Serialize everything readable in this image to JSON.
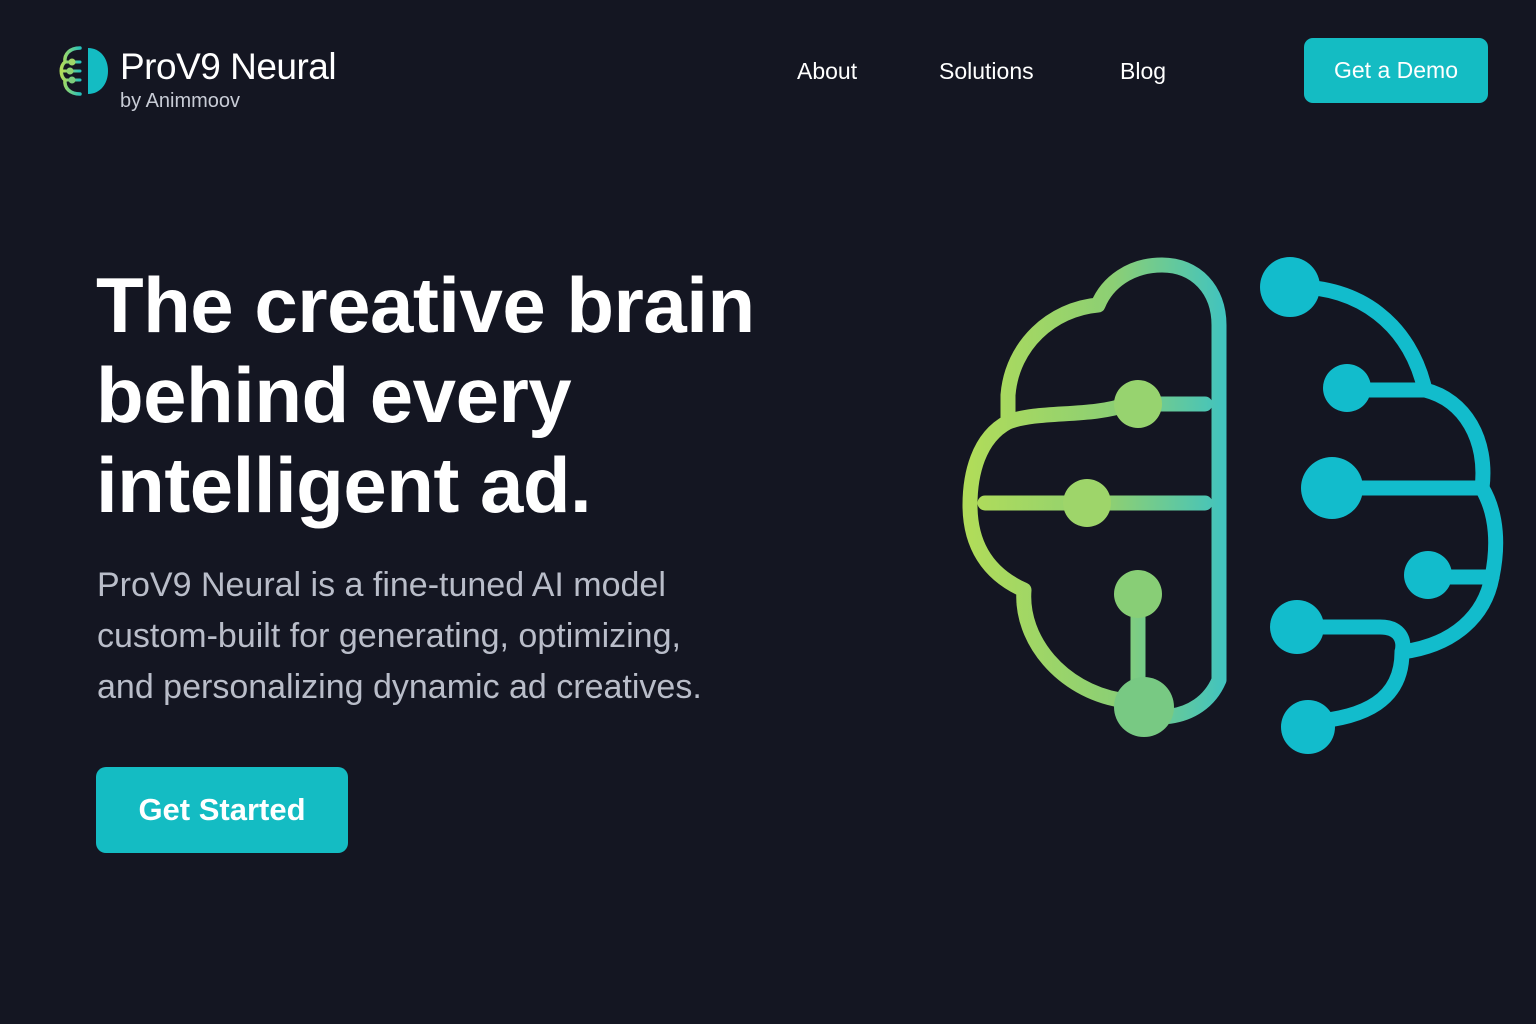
{
  "header": {
    "brand_name": "ProV9 Neural",
    "brand_sub": "by Animmoov",
    "nav": {
      "about": "About",
      "solutions": "Solutions",
      "blog": "Blog"
    },
    "demo_button": "Get a Demo"
  },
  "hero": {
    "title_lines": [
      "The creative brain",
      "behind every",
      "intelligent ad."
    ],
    "description_lines": [
      "ProV9 Neural is a fine-tuned AI model",
      "custom-built for generating, optimizing,",
      "and personalizing dynamic ad creatives."
    ],
    "cta_button": "Get Started"
  },
  "icons": {
    "logo": "brain-logo-icon",
    "illustration": "neural-brain-icon"
  },
  "colors": {
    "background": "#141622",
    "accent": "#14bcc3",
    "gradient_green": "#b0dc5a",
    "gradient_teal": "#10bccc",
    "muted_text": "#b9bdc9"
  }
}
